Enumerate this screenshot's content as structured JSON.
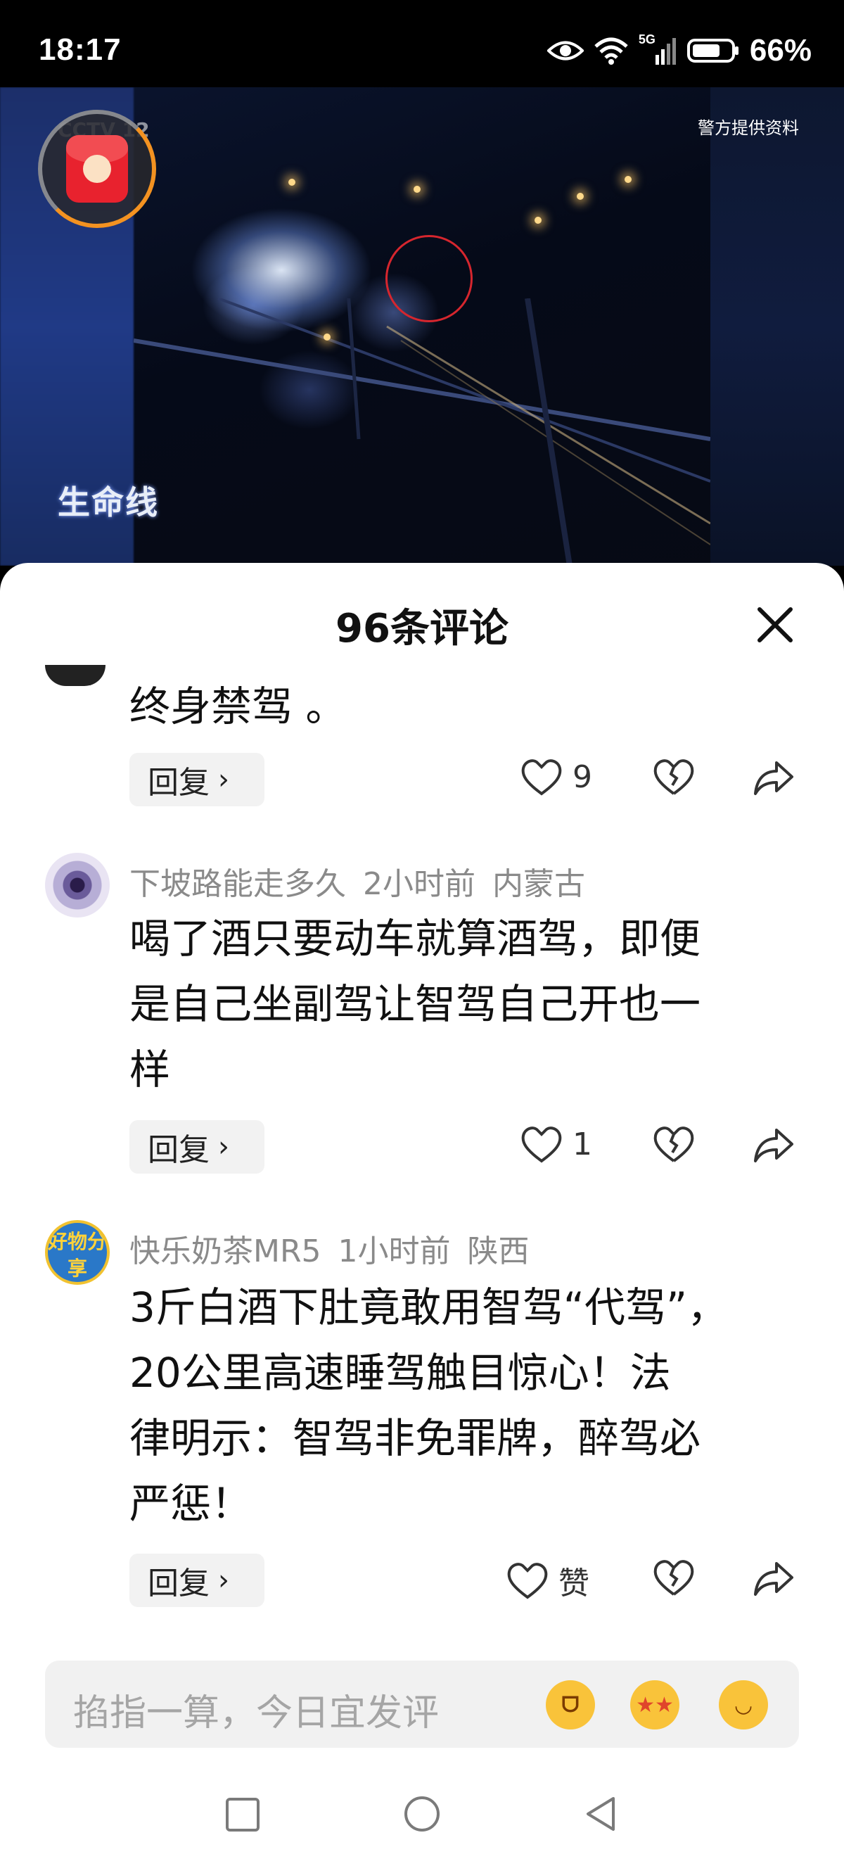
{
  "status_bar": {
    "time": "18:17",
    "network": "5G",
    "battery": "66%"
  },
  "video": {
    "credit": "警方提供资料",
    "channel_mark": "CCTV 12",
    "program_logo": "生命线"
  },
  "sheet": {
    "title": "96条评论"
  },
  "comments": [
    {
      "text_lines": [
        "终身禁驾 。"
      ],
      "reply_label": "回复",
      "likes": "9"
    },
    {
      "user": "下坡路能走多久",
      "time": "2小时前",
      "location": "内蒙古",
      "text_lines": [
        "喝了酒只要动车就算酒驾，即便",
        "是自己坐副驾让智驾自己开也一",
        "样"
      ],
      "reply_label": "回复",
      "likes": "1"
    },
    {
      "user": "快乐奶茶MR5",
      "time": "1小时前",
      "location": "陕西",
      "avatar_text": "好物分享",
      "text_lines": [
        "3斤白酒下肚竟敢用智驾“代驾”，",
        "20公里高速睡驾触目惊心！法",
        "律明示：智驾非免罪牌，醉驾必",
        "严惩！"
      ],
      "reply_label": "回复",
      "likes": "赞"
    }
  ],
  "input": {
    "placeholder": "掐指一算，今日宜发评"
  },
  "colors": {
    "accent_orange": "#f39221",
    "red_packet": "#e8222e",
    "target_circle": "#d6262e"
  },
  "icons": [
    "eye-icon",
    "wifi-icon",
    "signal-icon",
    "battery-icon",
    "close-icon",
    "heart-icon",
    "broken-heart-icon",
    "share-icon",
    "grin-emoji",
    "star-eyes-emoji",
    "laugh-cry-emoji",
    "nav-recent-icon",
    "nav-home-icon",
    "nav-back-icon"
  ]
}
